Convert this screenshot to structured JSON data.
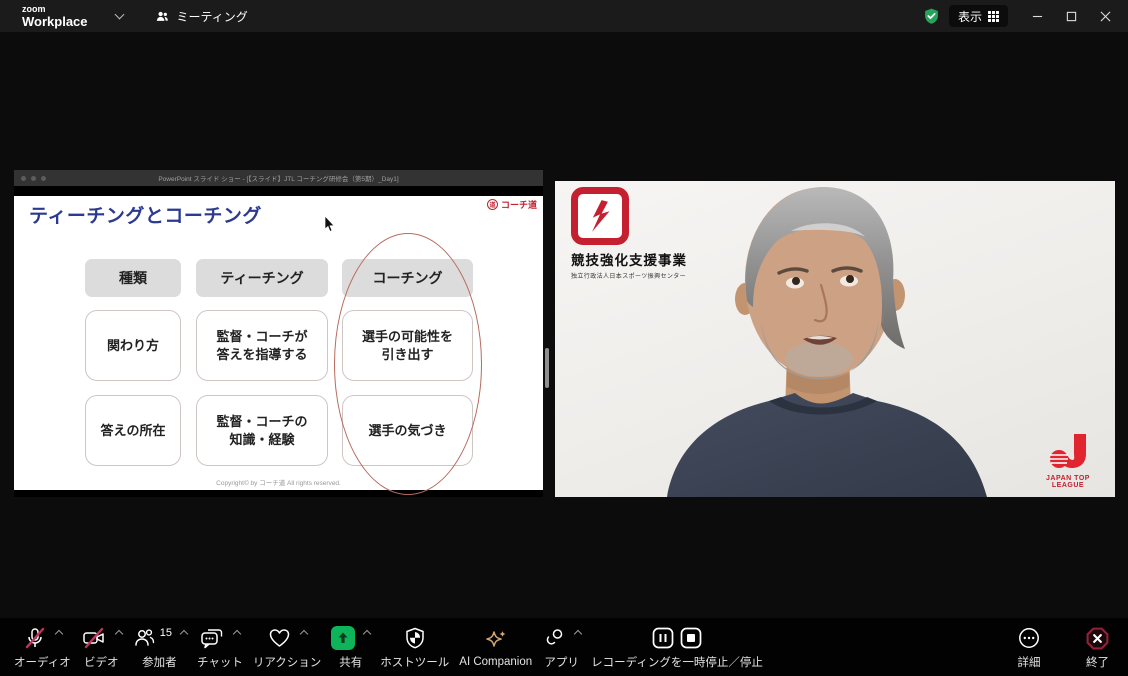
{
  "titlebar": {
    "brand_line1": "zoom",
    "brand_line2": "Workplace",
    "meeting_tab_label": "ミーティング",
    "view_button_label": "表示"
  },
  "share_panel": {
    "window_title": "PowerPoint スライド ショー - [【スライド】JTL コーチング研修会（第5期）_Day1]",
    "slide": {
      "title": "ティーチングとコーチング",
      "brand_logo_text": "コーチ道",
      "table": {
        "headers": [
          "種類",
          "ティーチング",
          "コーチング"
        ],
        "rows": [
          [
            [
              "関わり方"
            ],
            [
              "監督・コーチが",
              "答えを指導する"
            ],
            [
              "選手の可能性を",
              "引き出す"
            ]
          ],
          [
            [
              "答えの所在"
            ],
            [
              "監督・コーチの",
              "知識・経験"
            ],
            [
              "選手の気づき"
            ]
          ]
        ]
      },
      "highlighted_column": "コーチング",
      "copyright": "Copyright© by コーチ道 All rights reserved."
    }
  },
  "video_panel": {
    "program_badge": {
      "title": "競技強化支援事業",
      "subtitle": "独立行政法人日本スポーツ振興センター"
    },
    "league_badge": {
      "text": "JAPAN TOP LEAGUE"
    }
  },
  "toolbar": {
    "items": {
      "audio": {
        "label": "オーディオ",
        "muted": true
      },
      "video": {
        "label": "ビデオ",
        "muted": true
      },
      "participants": {
        "label": "参加者",
        "count": "15"
      },
      "chat": {
        "label": "チャット"
      },
      "reactions": {
        "label": "リアクション"
      },
      "share": {
        "label": "共有"
      },
      "host_tools": {
        "label": "ホストツール"
      },
      "ai_companion": {
        "label": "AI Companion"
      },
      "apps": {
        "label": "アプリ"
      },
      "recording": {
        "label": "レコーディングを一時停止／停止"
      },
      "more": {
        "label": "詳細"
      },
      "end": {
        "label": "終了"
      }
    }
  },
  "colors": {
    "accent_green": "#0db45a",
    "mute_red": "#c1335a",
    "end_red": "#8e2438",
    "ai_gold": "#d2a671",
    "slide_title_blue": "#2b3a90",
    "ellipse_red": "#b86a5e",
    "brand_red": "#c5202f"
  }
}
